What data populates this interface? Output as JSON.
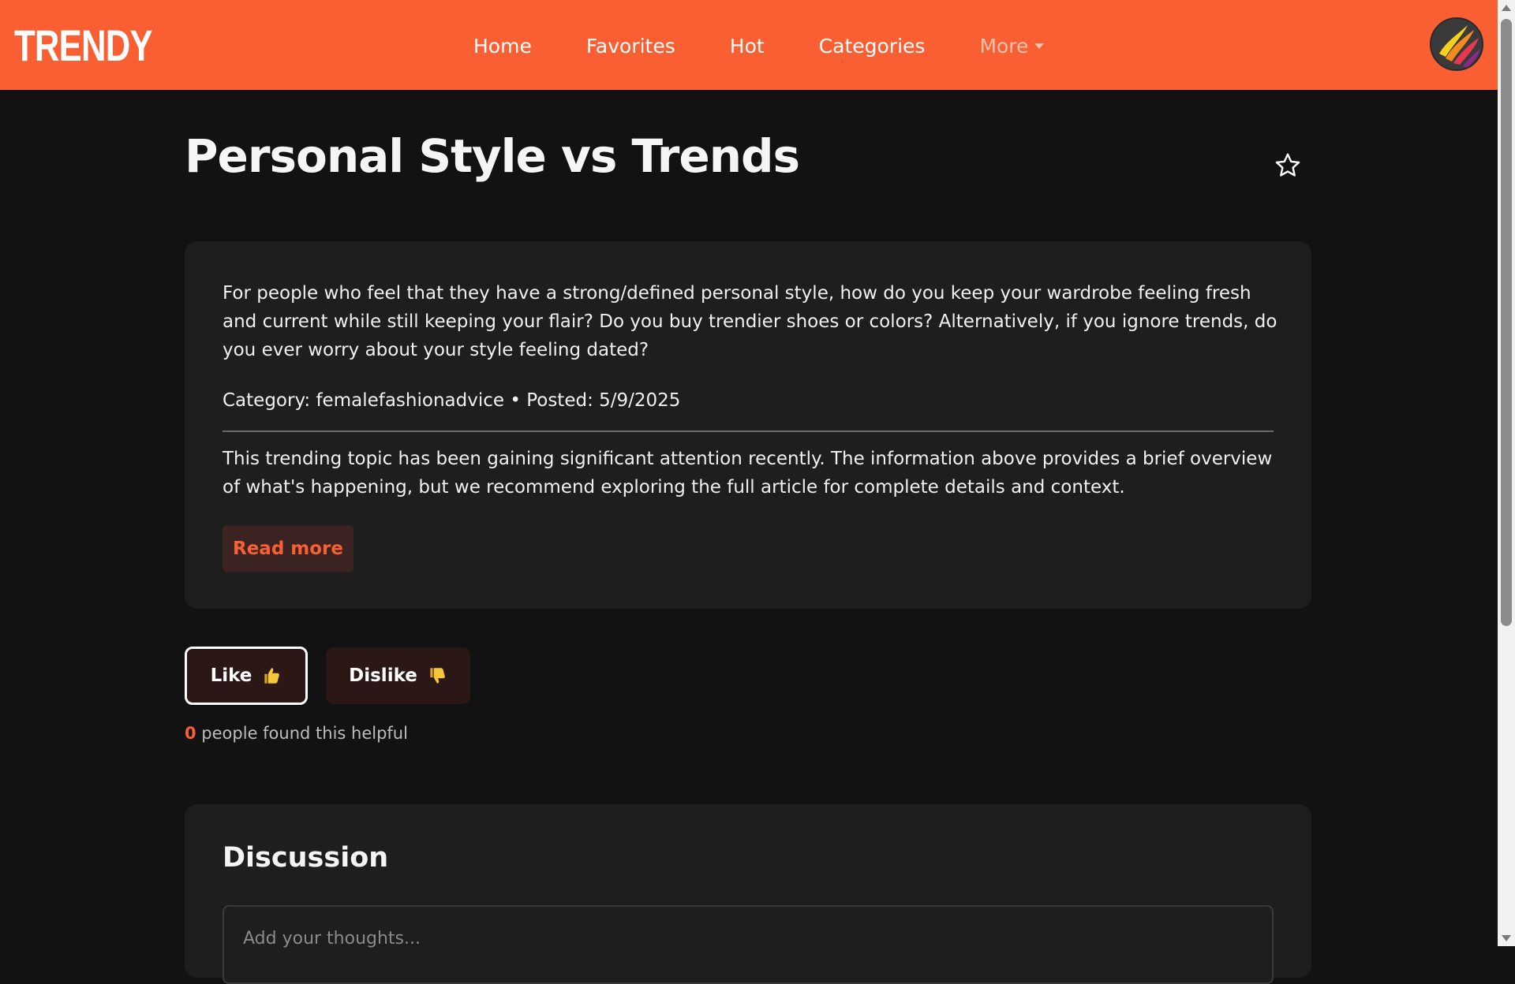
{
  "brand": {
    "name": "TRENDY"
  },
  "nav": {
    "items": [
      "Home",
      "Favorites",
      "Hot",
      "Categories"
    ],
    "more_label": "More"
  },
  "post": {
    "title": "Personal Style vs Trends",
    "summary": "For people who feel that they have a strong/defined personal style, how do you keep your wardrobe feeling fresh and current while still keeping your flair? Do you buy trendier shoes or colors? Alternatively, if you ignore trends, do you ever worry about your style feeling dated?",
    "meta": "Category: femalefashionadvice • Posted: 5/9/2025",
    "explanation": "This trending topic has been gaining significant attention recently. The information above provides a brief overview of what's happening, but we recommend exploring the full article for complete details and context.",
    "read_more_label": "Read more"
  },
  "reactions": {
    "like_label": "Like",
    "dislike_label": "Dislike",
    "helpful_count": "0",
    "helpful_text": " people found this helpful"
  },
  "discussion": {
    "title": "Discussion",
    "placeholder": "Add your thoughts..."
  },
  "colors": {
    "accent": "#f95f32",
    "background": "#121212",
    "card": "#1e1e1e"
  },
  "icons": {
    "favorite": "star-outline-icon",
    "like": "thumbs-up-icon",
    "dislike": "thumbs-down-icon",
    "avatar": "flame-logo-avatar"
  }
}
